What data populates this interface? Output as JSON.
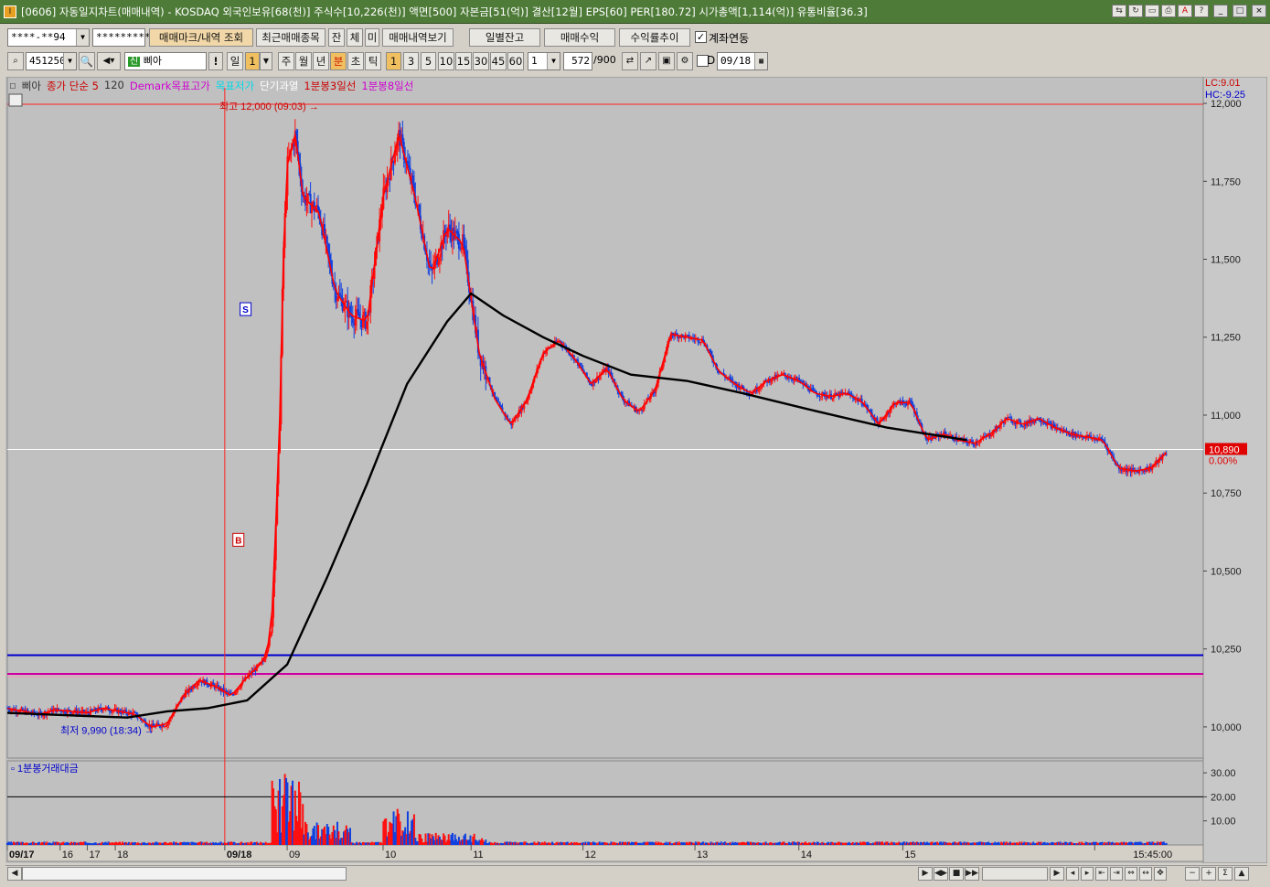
{
  "window": {
    "title": "[0606] 자동일지차트(매매내역) - KOSDAQ 외국인보유[68(천)] 주식수[10,226(천)] 액면[500] 자본금[51(억)] 결산[12월] EPS[60] PER[180.72] 시가총액[1,114(억)] 유통비율[36.3]"
  },
  "toolbar1": {
    "account": "****-**94",
    "password": "*********",
    "btn_marks": "매매마크/내역 조회",
    "btn_recent": "최근매매종목",
    "btn_jan": "잔",
    "btn_che": "체",
    "btn_mi": "미",
    "btn_history": "매매내역보기",
    "btn_daily_balance": "일별잔고",
    "btn_profit": "매매수익",
    "btn_return_trend": "수익률추이",
    "link_label": "계좌연동",
    "link_checked": "✓"
  },
  "toolbar2": {
    "stock_code": "451250",
    "stock_badge": "신",
    "stock_name": "삐아",
    "warn_label": "!",
    "period_day": "일",
    "period_day_value": "1",
    "period_week": "주",
    "period_month": "월",
    "period_year": "년",
    "period_min": "분",
    "period_sec": "초",
    "period_tick": "틱",
    "intervals": [
      "1",
      "3",
      "5",
      "10",
      "15",
      "30",
      "45",
      "60"
    ],
    "interval_value": "1",
    "count_value": "572",
    "count_max": "/900",
    "d_label": "D",
    "date_value": "09/18"
  },
  "legend": {
    "name": "삐아",
    "ma": "종가 단순 5",
    "ma_value": "120",
    "demark_high": "Demark목표고가",
    "demark_low": "목표저가",
    "short_overheat": "단기과열",
    "line3": "1분봉3일선",
    "line8": "1분봉8일선"
  },
  "chart_data": {
    "type": "candlestick",
    "title": "",
    "price_axis": {
      "ticks": [
        "12,000",
        "11,750",
        "11,500",
        "11,250",
        "11,000",
        "10,750",
        "10,500",
        "10,250",
        "10,000"
      ],
      "min": 9900,
      "max": 12050
    },
    "lc_label": "LC:9.01",
    "hc_label": "HC:-9.25",
    "current_price": "10,890",
    "current_change": "0.00%",
    "high_annotation": "최고 12,000 (09:03)",
    "low_annotation": "최저 9,990 (18:34)",
    "buy_marker": "B",
    "sell_marker": "S",
    "volume_label": "1분봉거래대금",
    "volume_axis": [
      "30.00",
      "20.00",
      "10.00"
    ],
    "time_axis": [
      "09/17",
      "16",
      "17",
      "18",
      "09/18",
      "09",
      "10",
      "11",
      "12",
      "13",
      "14",
      "15",
      "15:45:00"
    ],
    "blue_line": 10230,
    "pink_line": 10170,
    "white_line": 10890,
    "ma120_points": [
      [
        0,
        10045
      ],
      [
        0.05,
        10040
      ],
      [
        0.1,
        10035
      ],
      [
        0.15,
        10030
      ],
      [
        0.2,
        10050
      ],
      [
        0.25,
        10060
      ],
      [
        0.3,
        10085
      ],
      [
        0.35,
        10200
      ],
      [
        0.4,
        10480
      ],
      [
        0.45,
        10780
      ],
      [
        0.5,
        11100
      ],
      [
        0.55,
        11300
      ],
      [
        0.58,
        11390
      ],
      [
        0.62,
        11320
      ],
      [
        0.67,
        11250
      ],
      [
        0.72,
        11190
      ],
      [
        0.78,
        11130
      ],
      [
        0.85,
        11110
      ],
      [
        0.92,
        11070
      ],
      [
        1.0,
        11020
      ],
      [
        1.05,
        10990
      ],
      [
        1.1,
        10960
      ],
      [
        1.15,
        10940
      ],
      [
        1.2,
        10920
      ]
    ],
    "price_points": [
      [
        0,
        10060
      ],
      [
        0.02,
        10050
      ],
      [
        0.04,
        10040
      ],
      [
        0.06,
        10055
      ],
      [
        0.08,
        10050
      ],
      [
        0.1,
        10045
      ],
      [
        0.12,
        10060
      ],
      [
        0.14,
        10050
      ],
      [
        0.16,
        10040
      ],
      [
        0.18,
        10000
      ],
      [
        0.2,
        10010
      ],
      [
        0.22,
        10100
      ],
      [
        0.24,
        10150
      ],
      [
        0.26,
        10130
      ],
      [
        0.28,
        10100
      ],
      [
        0.3,
        10160
      ],
      [
        0.32,
        10210
      ],
      [
        0.33,
        10300
      ],
      [
        0.34,
        10900
      ],
      [
        0.345,
        11500
      ],
      [
        0.35,
        11800
      ],
      [
        0.36,
        11900
      ],
      [
        0.37,
        11700
      ],
      [
        0.39,
        11650
      ],
      [
        0.41,
        11400
      ],
      [
        0.43,
        11320
      ],
      [
        0.45,
        11300
      ],
      [
        0.47,
        11700
      ],
      [
        0.49,
        11900
      ],
      [
        0.51,
        11700
      ],
      [
        0.53,
        11450
      ],
      [
        0.55,
        11600
      ],
      [
        0.57,
        11550
      ],
      [
        0.59,
        11200
      ],
      [
        0.61,
        11050
      ],
      [
        0.63,
        10970
      ],
      [
        0.65,
        11050
      ],
      [
        0.67,
        11200
      ],
      [
        0.69,
        11240
      ],
      [
        0.71,
        11180
      ],
      [
        0.73,
        11100
      ],
      [
        0.75,
        11150
      ],
      [
        0.77,
        11050
      ],
      [
        0.79,
        11010
      ],
      [
        0.81,
        11080
      ],
      [
        0.83,
        11260
      ],
      [
        0.85,
        11250
      ],
      [
        0.87,
        11240
      ],
      [
        0.89,
        11140
      ],
      [
        0.91,
        11100
      ],
      [
        0.93,
        11070
      ],
      [
        0.95,
        11110
      ],
      [
        0.97,
        11130
      ],
      [
        0.99,
        11110
      ],
      [
        1.01,
        11070
      ],
      [
        1.03,
        11060
      ],
      [
        1.05,
        11070
      ],
      [
        1.07,
        11040
      ],
      [
        1.09,
        10970
      ],
      [
        1.11,
        11040
      ],
      [
        1.13,
        11040
      ],
      [
        1.15,
        10920
      ],
      [
        1.17,
        10940
      ],
      [
        1.19,
        10920
      ],
      [
        1.21,
        10910
      ],
      [
        1.23,
        10940
      ],
      [
        1.25,
        10990
      ],
      [
        1.27,
        10970
      ],
      [
        1.29,
        10990
      ],
      [
        1.31,
        10960
      ],
      [
        1.33,
        10940
      ],
      [
        1.35,
        10930
      ],
      [
        1.37,
        10920
      ],
      [
        1.39,
        10830
      ],
      [
        1.41,
        10820
      ],
      [
        1.43,
        10830
      ],
      [
        1.45,
        10880
      ]
    ]
  },
  "scrollbar": {
    "controls": [
      "▶",
      "◀▶",
      "■",
      "▶▶",
      "−",
      "+",
      "Σ",
      "▲"
    ]
  }
}
